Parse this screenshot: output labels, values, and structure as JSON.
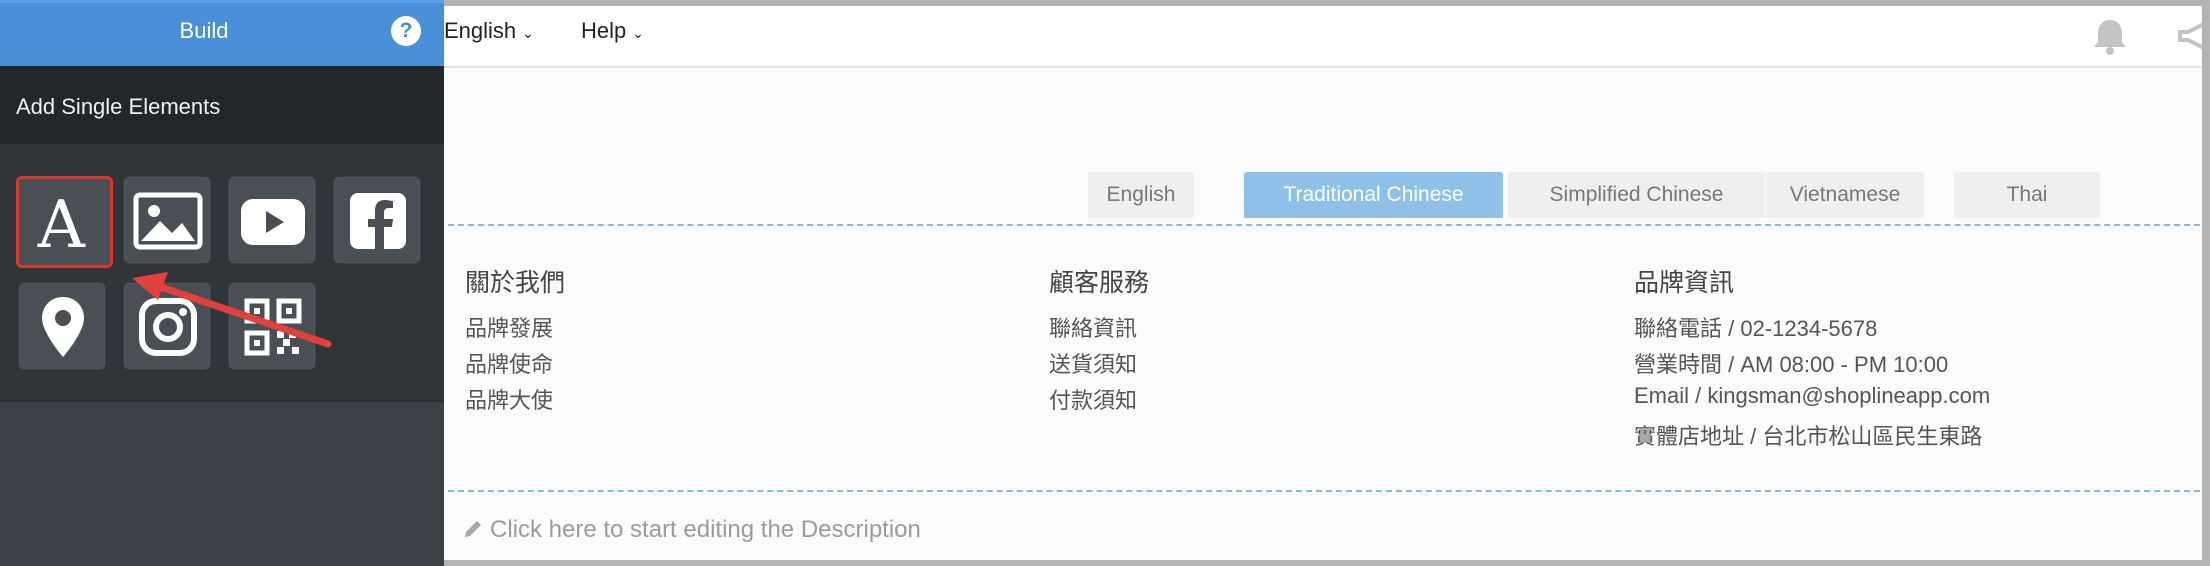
{
  "sidebar": {
    "build_title": "Build",
    "help_symbol": "?",
    "section_title": "Add Single Elements",
    "elements": [
      {
        "icon": "text-icon",
        "selected": true
      },
      {
        "icon": "image-icon",
        "selected": false
      },
      {
        "icon": "youtube-icon",
        "selected": false
      },
      {
        "icon": "facebook-icon",
        "selected": false
      },
      {
        "icon": "map-pin-icon",
        "selected": false
      },
      {
        "icon": "instagram-icon",
        "selected": false
      },
      {
        "icon": "qr-code-icon",
        "selected": false
      }
    ],
    "highlight_color": "#d9372b"
  },
  "topnav": {
    "language_label": "English",
    "help_label": "Help"
  },
  "language_tabs": [
    {
      "label": "English",
      "active": false
    },
    {
      "label": "Traditional Chinese",
      "active": true
    },
    {
      "label": "Simplified Chinese",
      "active": false
    },
    {
      "label": "Vietnamese",
      "active": false
    },
    {
      "label": "Thai",
      "active": false
    }
  ],
  "footer_columns": [
    {
      "title": "關於我們",
      "items": [
        "品牌發展",
        "品牌使命",
        "品牌大使"
      ]
    },
    {
      "title": "顧客服務",
      "items": [
        "聯絡資訊",
        "送貨須知",
        "付款須知"
      ]
    },
    {
      "title": "品牌資訊",
      "items": [
        "聯絡電話 / 02-1234-5678",
        "營業時間 / AM 08:00 - PM 10:00",
        "Email / kingsman@shoplineapp.com",
        "實體店地址 / 台北市松山區民生東路"
      ]
    }
  ],
  "description_placeholder": "Click here to start editing the Description",
  "colors": {
    "accent": "#4a90d9",
    "active_tab": "#8ec0e8",
    "sidebar_bg": "#3a3f45"
  }
}
